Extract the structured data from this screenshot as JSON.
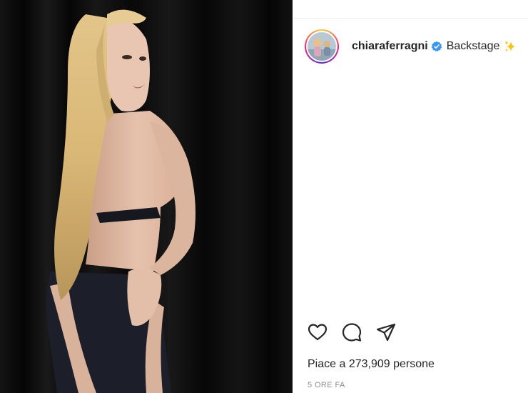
{
  "post": {
    "username": "chiaraferragni",
    "caption": "Backstage",
    "likes_text": "Piace a 273,909 persone",
    "time_text": "5 ORE FA",
    "verified": true
  },
  "icons": {
    "verified": "verified-badge-icon",
    "caption_emoji": "sparkles-emoji",
    "like": "heart-icon",
    "comment": "comment-bubble-icon",
    "share": "share-paper-plane-icon"
  },
  "colors": {
    "verified_blue": "#3897f0",
    "text": "#262626",
    "muted": "#8e8e8e"
  }
}
